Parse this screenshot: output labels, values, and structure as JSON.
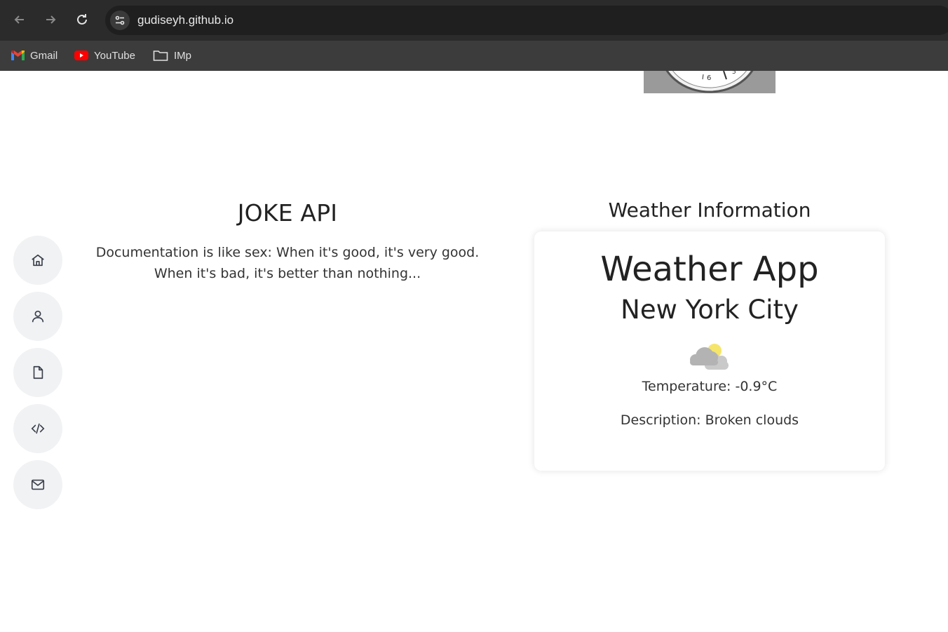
{
  "browser": {
    "url": "gudiseyh.github.io",
    "bookmarks": [
      {
        "label": "Gmail",
        "icon": "gmail-icon"
      },
      {
        "label": "YouTube",
        "icon": "youtube-icon"
      },
      {
        "label": "IMp",
        "icon": "folder-icon"
      }
    ]
  },
  "clock": {
    "numerals": [
      "6"
    ]
  },
  "sidebar": {
    "items": [
      {
        "icon": "home-icon"
      },
      {
        "icon": "user-icon"
      },
      {
        "icon": "document-icon"
      },
      {
        "icon": "code-icon"
      },
      {
        "icon": "mail-icon"
      }
    ]
  },
  "joke": {
    "title": "JOKE API",
    "text_line1": "Documentation is like sex: When it's good, it's very good.",
    "text_line2": "When it's bad, it's better than nothing..."
  },
  "weather": {
    "section_title": "Weather Information",
    "app_title": "Weather App",
    "city": "New York City",
    "temperature": "Temperature: -0.9°C",
    "description": "Description: Broken clouds",
    "icon": "broken-clouds-icon"
  }
}
